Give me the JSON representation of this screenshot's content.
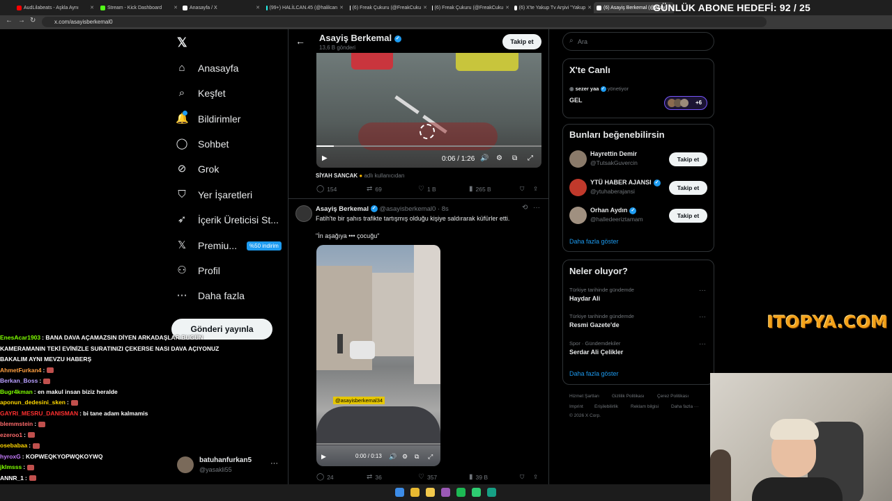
{
  "browser": {
    "tabs": [
      {
        "label": "AudLilabeats - Aşkla Aynı",
        "color": "#ff0000"
      },
      {
        "label": "Stream - Kick Dashboard",
        "color": "#53fc18"
      },
      {
        "label": "Anasayfa / X",
        "color": "#ffffff"
      },
      {
        "label": "(99+) HALİLCAN.45 (@halilcan",
        "color": "#25f4ee"
      },
      {
        "label": "(6) Freak Çukuru (@FreakCuku",
        "color": "#ffffff"
      },
      {
        "label": "(6) Freak Çukuru (@FreakCuku",
        "color": "#ffffff"
      },
      {
        "label": "(6) X'te Yakup Tv Arşivi \"Yakup",
        "color": "#ffffff"
      },
      {
        "label": "(6) Asayiş Berkemal (@asay",
        "color": "#ffffff"
      }
    ],
    "url": "x.com/asayisberkemal0"
  },
  "overlay": {
    "goal": "GÜNLÜK ABONE HEDEFİ: 92 / 25",
    "logo": "ITOPYA.COM"
  },
  "sidebar": {
    "items": [
      {
        "label": "Anasayfa",
        "icon": "home-icon",
        "glyph": "⌂"
      },
      {
        "label": "Keşfet",
        "icon": "search-icon",
        "glyph": "⌕"
      },
      {
        "label": "Bildirimler",
        "icon": "bell-icon",
        "glyph": "🔔"
      },
      {
        "label": "Sohbet",
        "icon": "chat-icon",
        "glyph": "◯"
      },
      {
        "label": "Grok",
        "icon": "grok-icon",
        "glyph": "⊘"
      },
      {
        "label": "Yer İşaretleri",
        "icon": "bookmark-icon",
        "glyph": "⛉"
      },
      {
        "label": "İçerik Üreticisi St...",
        "icon": "rocket-icon",
        "glyph": "➶"
      },
      {
        "label": "Premiu...",
        "icon": "x-logo-icon",
        "glyph": "𝕏"
      },
      {
        "label": "Profil",
        "icon": "person-icon",
        "glyph": "⚇"
      },
      {
        "label": "Daha fazla",
        "icon": "more-icon",
        "glyph": "⋯"
      }
    ],
    "premium_badge": "%50 indirim",
    "post_button": "Gönderi yayınla",
    "account": {
      "name": "batuhanfurkan5",
      "handle": "@yasakli55"
    }
  },
  "chat": [
    {
      "user": "EnesAcar1903",
      "color": "#7fff00",
      "text": ": BANA DAVA AÇAMAZSIN DİYEN ARKADAŞLAR BUGÜN"
    },
    {
      "user": "",
      "color": "#ffffff",
      "text": "KAMERAMANIN TEKİ EVİNİZLE SURATINIZI ÇEKERSE NASI DAVA AÇIYONUZ"
    },
    {
      "user": "",
      "color": "#ffffff",
      "text": "BAKALIM AYNI MEVZU HABERŞ"
    },
    {
      "user": "AhmetFurkan4",
      "color": "#ff9f40",
      "text": ":"
    },
    {
      "user": "Berkan_Boss",
      "color": "#b9a0ff",
      "text": ":"
    },
    {
      "user": "Bugr4kman",
      "color": "#7fff00",
      "text": ": en makul insan biziz heralde"
    },
    {
      "user": "aponun_dedesini_sken",
      "color": "#ffd700",
      "text": ":"
    },
    {
      "user": "GAYRI_MESRU_DANISMAN",
      "color": "#ff3030",
      "text": ": bi tane adam kalmamis"
    },
    {
      "user": "blemmstein",
      "color": "#ff6b6b",
      "text": ":"
    },
    {
      "user": "ezeroo1",
      "color": "#ff6b6b",
      "text": ":"
    },
    {
      "user": "osebabaa",
      "color": "#ffd700",
      "text": ":"
    },
    {
      "user": "hyroxG",
      "color": "#c77dff",
      "text": ": KOPWEQKYOPWQKOYWQ"
    },
    {
      "user": "jklmsss",
      "color": "#7fff00",
      "text": ":"
    },
    {
      "user": "ANNR_1",
      "color": "#ffffff",
      "text": ":"
    },
    {
      "user": "bjklihamsi",
      "color": "#1e90ff",
      "text": ": HAHAHAHAHAHAHAH"
    }
  ],
  "header": {
    "name": "Asayiş Berkemal",
    "posts": "13,6 B gönderi",
    "follow": "Takip et"
  },
  "post1": {
    "time": "0:06 / 1:26",
    "caption_user": "SİYAH SANCAK",
    "caption_suffix": "adlı kullanıcıdan",
    "stats": {
      "replies": "154",
      "reposts": "69",
      "likes": "1 B",
      "views": "265 B"
    }
  },
  "post2": {
    "name": "Asayiş Berkemal",
    "handle": "@asayisberkemal0 · 8s",
    "text1": "Fatih'te bir şahıs trafikte tartışmış olduğu kişiye saldırarak küfürler etti.",
    "text2": "\"İn aşağıya ••• çocuğu\"",
    "watermark": "@asayisberkemal34",
    "time": "0:00 / 0:13",
    "stats": {
      "replies": "24",
      "reposts": "36",
      "likes": "357",
      "views": "39 B"
    }
  },
  "right": {
    "search_placeholder": "Ara",
    "live": {
      "title": "X'te Canlı",
      "host": "sezer yaa",
      "host_role": "yönetiyor",
      "space_title": "GEL",
      "listeners": "+6"
    },
    "suggestions": {
      "title": "Bunları beğenebilirsin",
      "items": [
        {
          "name": "Hayrettin Demir",
          "handle": "@TutsakGuvercin",
          "button": "Takip et"
        },
        {
          "name": "YTÜ HABER AJANSI",
          "handle": "@ytuhaberajansi",
          "button": "Takip et"
        },
        {
          "name": "Orhan Aydın",
          "handle": "@halledeeriztamam",
          "button": "Takip et"
        }
      ],
      "more": "Daha fazla göster"
    },
    "trends": {
      "title": "Neler oluyor?",
      "items": [
        {
          "context": "Türkiye tarihinde gündemde",
          "name": "Haydar Ali"
        },
        {
          "context": "Türkiye tarihinde gündemde",
          "name": "Resmi Gazete'de"
        },
        {
          "context": "Spor · Gündemdekiler",
          "name": "Serdar Ali Çelikler"
        }
      ],
      "more": "Daha fazla göster"
    },
    "footer": {
      "line1": [
        "Hizmet Şartları",
        "Gizlilik Politikası",
        "Çerez Politikası"
      ],
      "line2": [
        "Imprint",
        "Erişilebilirlik",
        "Reklam bilgisi",
        "Daha fazla ···"
      ],
      "copyright": "© 2026 X Corp."
    }
  }
}
